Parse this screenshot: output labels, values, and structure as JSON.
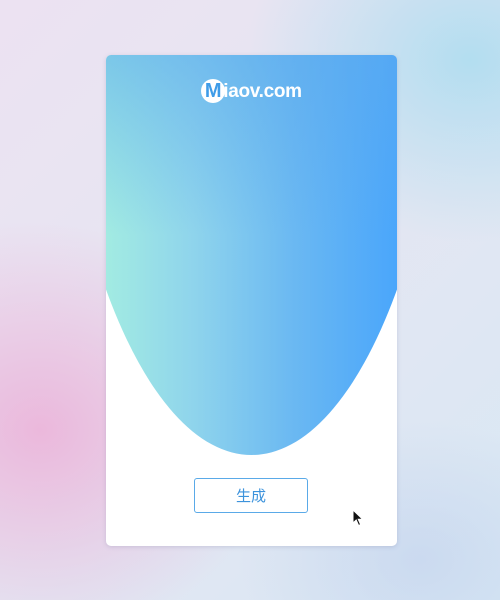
{
  "brand": {
    "logo_letter": "M",
    "logo_text": "iaov.com"
  },
  "actions": {
    "generate_label": "生成"
  },
  "colors": {
    "gradient_start": "#a2ebe2",
    "gradient_end": "#4aa6fb",
    "button_border": "#5aaae8",
    "button_text": "#3d93dc"
  },
  "icons": {
    "pointer": "mouse-pointer-icon"
  }
}
